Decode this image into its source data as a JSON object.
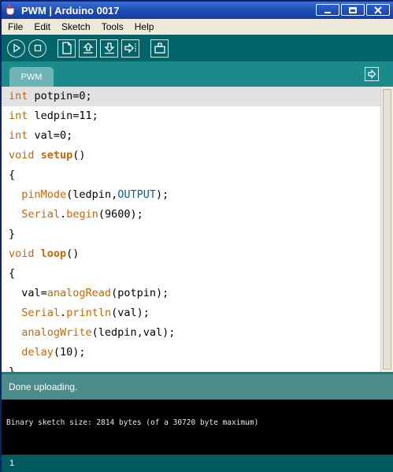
{
  "window": {
    "title": "PWM | Arduino 0017"
  },
  "menu": {
    "items": [
      "File",
      "Edit",
      "Sketch",
      "Tools",
      "Help"
    ]
  },
  "toolbar": {
    "buttons": [
      {
        "name": "verify",
        "icon": "play-icon"
      },
      {
        "name": "stop",
        "icon": "stop-icon"
      },
      {
        "name": "new",
        "icon": "new-file-icon"
      },
      {
        "name": "open",
        "icon": "open-arrow-up-icon"
      },
      {
        "name": "save",
        "icon": "save-arrow-down-icon"
      },
      {
        "name": "upload",
        "icon": "upload-arrow-right-icon"
      },
      {
        "name": "serial-monitor",
        "icon": "serial-monitor-icon"
      }
    ]
  },
  "tabs": [
    {
      "label": "PWM"
    }
  ],
  "editor": {
    "lines": [
      [
        {
          "t": "int",
          "c": "kw"
        },
        {
          "t": " potpin=0;",
          "c": ""
        }
      ],
      [
        {
          "t": "int",
          "c": "kw"
        },
        {
          "t": " ledpin=11;",
          "c": ""
        }
      ],
      [
        {
          "t": "int",
          "c": "kw"
        },
        {
          "t": " val=0;",
          "c": ""
        }
      ],
      [
        {
          "t": "void",
          "c": "kw"
        },
        {
          "t": " ",
          "c": ""
        },
        {
          "t": "setup",
          "c": "fn"
        },
        {
          "t": "()",
          "c": ""
        }
      ],
      [
        {
          "t": "{",
          "c": ""
        }
      ],
      [
        {
          "t": "  ",
          "c": ""
        },
        {
          "t": "pinMode",
          "c": "kw"
        },
        {
          "t": "(ledpin,",
          "c": ""
        },
        {
          "t": "OUTPUT",
          "c": "cn"
        },
        {
          "t": ");",
          "c": ""
        }
      ],
      [
        {
          "t": "  ",
          "c": ""
        },
        {
          "t": "Serial",
          "c": "kw"
        },
        {
          "t": ".",
          "c": ""
        },
        {
          "t": "begin",
          "c": "kw"
        },
        {
          "t": "(9600);",
          "c": ""
        }
      ],
      [
        {
          "t": "}",
          "c": ""
        }
      ],
      [
        {
          "t": "void",
          "c": "kw"
        },
        {
          "t": " ",
          "c": ""
        },
        {
          "t": "loop",
          "c": "fn"
        },
        {
          "t": "()",
          "c": ""
        }
      ],
      [
        {
          "t": "{",
          "c": ""
        }
      ],
      [
        {
          "t": "  val=",
          "c": ""
        },
        {
          "t": "analogRead",
          "c": "kw"
        },
        {
          "t": "(potpin);",
          "c": ""
        }
      ],
      [
        {
          "t": "  ",
          "c": ""
        },
        {
          "t": "Serial",
          "c": "kw"
        },
        {
          "t": ".",
          "c": ""
        },
        {
          "t": "println",
          "c": "kw"
        },
        {
          "t": "(val);",
          "c": ""
        }
      ],
      [
        {
          "t": "  ",
          "c": ""
        },
        {
          "t": "analogWrite",
          "c": "kw"
        },
        {
          "t": "(ledpin,val);",
          "c": ""
        }
      ],
      [
        {
          "t": "  ",
          "c": ""
        },
        {
          "t": "delay",
          "c": "kw"
        },
        {
          "t": "(10);",
          "c": ""
        }
      ],
      [
        {
          "t": "}",
          "c": ""
        }
      ]
    ]
  },
  "status": {
    "message": "Done uploading."
  },
  "console": {
    "text": "Binary sketch size: 2814 bytes (of a 30720 byte maximum)"
  },
  "footer": {
    "line_number": "1"
  },
  "colors": {
    "keyword": "#cc6600",
    "constant": "#006699",
    "toolbar": "#006468",
    "tabbar": "#1a8a8a",
    "status": "#4a8c8c"
  }
}
